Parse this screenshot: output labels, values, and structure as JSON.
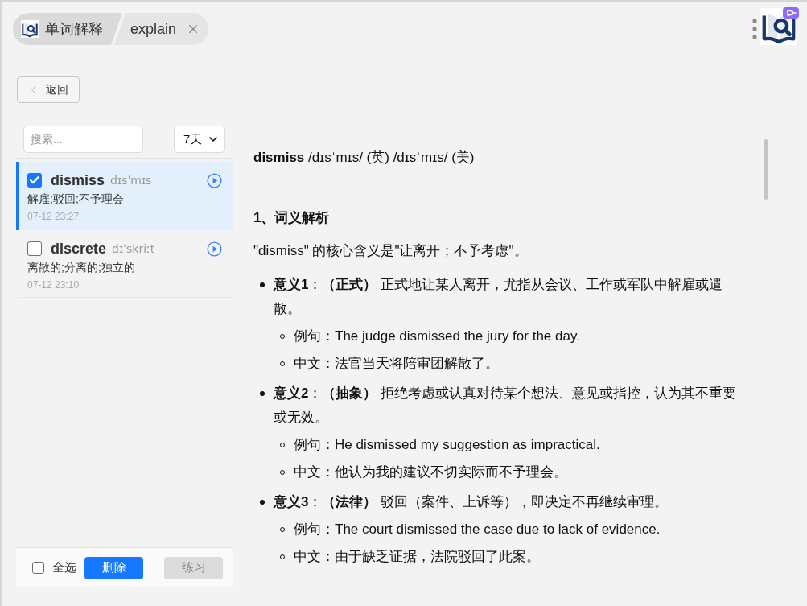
{
  "tabs": [
    {
      "label": "单词解释",
      "kind": "app"
    },
    {
      "label": "explain",
      "kind": "page"
    }
  ],
  "back_button": {
    "label": "返回"
  },
  "word_list": {
    "search": {
      "placeholder": "搜索..."
    },
    "range": {
      "value": "7天"
    },
    "items": [
      {
        "word": "dismiss",
        "phonetic": "dɪsˈmɪs",
        "meaning": "解雇;驳回;不予理会",
        "time": "07-12 23:27",
        "checked": true,
        "selected": true
      },
      {
        "word": "discrete",
        "phonetic": "dɪˈskriːt",
        "meaning": "离散的;分离的;独立的",
        "time": "07-12 23:10",
        "checked": false,
        "selected": false
      }
    ],
    "select_all": {
      "label": "全选",
      "checked": false
    },
    "buttons": [
      {
        "label": "删除",
        "disabled": false
      },
      {
        "label": "练习",
        "disabled": true
      }
    ]
  },
  "explanation": {
    "headline": "**dismiss** /dɪsˈmɪs/ (英) /dɪsˈmɪs/ (美)",
    "sections": [
      {
        "heading": "1、词义解析",
        "intro": "\"dismiss\" 的核心含义是\"让离开；不予考虑\"。",
        "items": [
          {
            "text": "**意义1**：**（正式）** 正式地让某人离开，尤指从会议、工作或军队中解雇或遣散。",
            "children": [
              {
                "text": "例句：The judge dismissed the jury for the day."
              },
              {
                "text": "中文：法官当天将陪审团解散了。"
              }
            ]
          },
          {
            "text": "**意义2**：**（抽象）** 拒绝考虑或认真对待某个想法、意见或指控，认为其不重要或无效。",
            "children": [
              {
                "text": "例句：He dismissed my suggestion as impractical."
              },
              {
                "text": "中文：他认为我的建议不切实际而不予理会。"
              }
            ]
          },
          {
            "text": "**意义3**：**（法律）** 驳回（案件、上诉等），即决定不再继续审理。",
            "children": [
              {
                "text": "例句：The court dismissed the case due to lack of evidence."
              },
              {
                "text": "中文：由于缺乏证据，法院驳回了此案。"
              }
            ]
          }
        ]
      }
    ]
  }
}
